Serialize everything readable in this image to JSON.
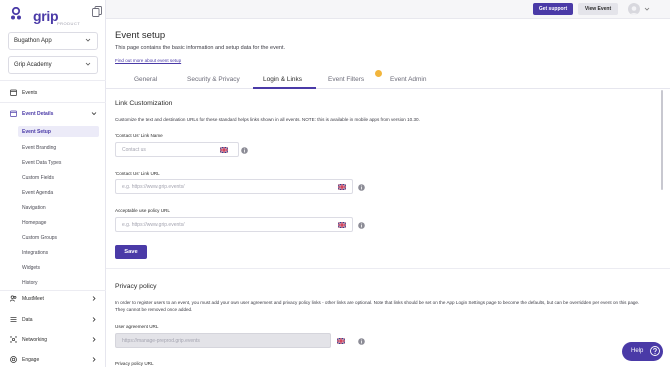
{
  "app": {
    "logo_text": "grip",
    "logo_sub": "PRODUCT"
  },
  "sidebar": {
    "app_select": "Bugathon App",
    "academy_select": "Grip Academy",
    "items": [
      {
        "label": "Events",
        "icon": "calendar-icon"
      },
      {
        "label": "Event Details",
        "icon": "calendar-icon"
      },
      {
        "label": "MustMeet",
        "icon": "people-icon"
      },
      {
        "label": "Data",
        "icon": "list-icon"
      },
      {
        "label": "Networking",
        "icon": "network-icon"
      },
      {
        "label": "Engage",
        "icon": "target-icon"
      }
    ],
    "sub_items": [
      "Event Setup",
      "Event Branding",
      "Event Data Types",
      "Custom Fields",
      "Event Agenda",
      "Navigation",
      "Homepage",
      "Custom Groups",
      "Integrations",
      "Widgets",
      "History"
    ]
  },
  "topbar": {
    "support_label": "Get support",
    "view_event_label": "View Event"
  },
  "page": {
    "title": "Event setup",
    "description": "This page contains the basic information and setup data for the event.",
    "link": "Find out more about event setup"
  },
  "tabs": [
    "General",
    "Security & Privacy",
    "Login & Links",
    "Event Filters",
    "Event Admin"
  ],
  "active_tab": "Login & Links",
  "link_customization": {
    "title": "Link Customization",
    "description": "Customize the text and destination URLs for these standard helps links shown in all events. NOTE: this is available in mobile apps from version 10.30.",
    "contact_name_label": "'Contact Us' Link Name",
    "contact_name_placeholder": "Contact us",
    "contact_url_label": "'Contact Us' Link URL",
    "contact_url_placeholder": "e.g. https://www.grip.events/",
    "aup_label": "Acceptable use policy URL",
    "aup_placeholder": "e.g. https://www.grip.events/",
    "save_label": "Save"
  },
  "privacy_policy": {
    "title": "Privacy policy",
    "description": "In order to register users to an event, you must add your own user agreement and privacy policy links - other links are optional. Note that links should be set on the App Login Settings page to become the defaults, but can be overridden per event on this page. They cannot be removed once added.",
    "user_agreement_label": "User agreement URL",
    "user_agreement_value": "https://manage-preprod.grip.events",
    "privacy_url_label": "Privacy policy URL"
  },
  "help": {
    "label": "Help"
  },
  "colors": {
    "brand": "#4a3aa7",
    "accent_dot": "#f2b53c"
  }
}
